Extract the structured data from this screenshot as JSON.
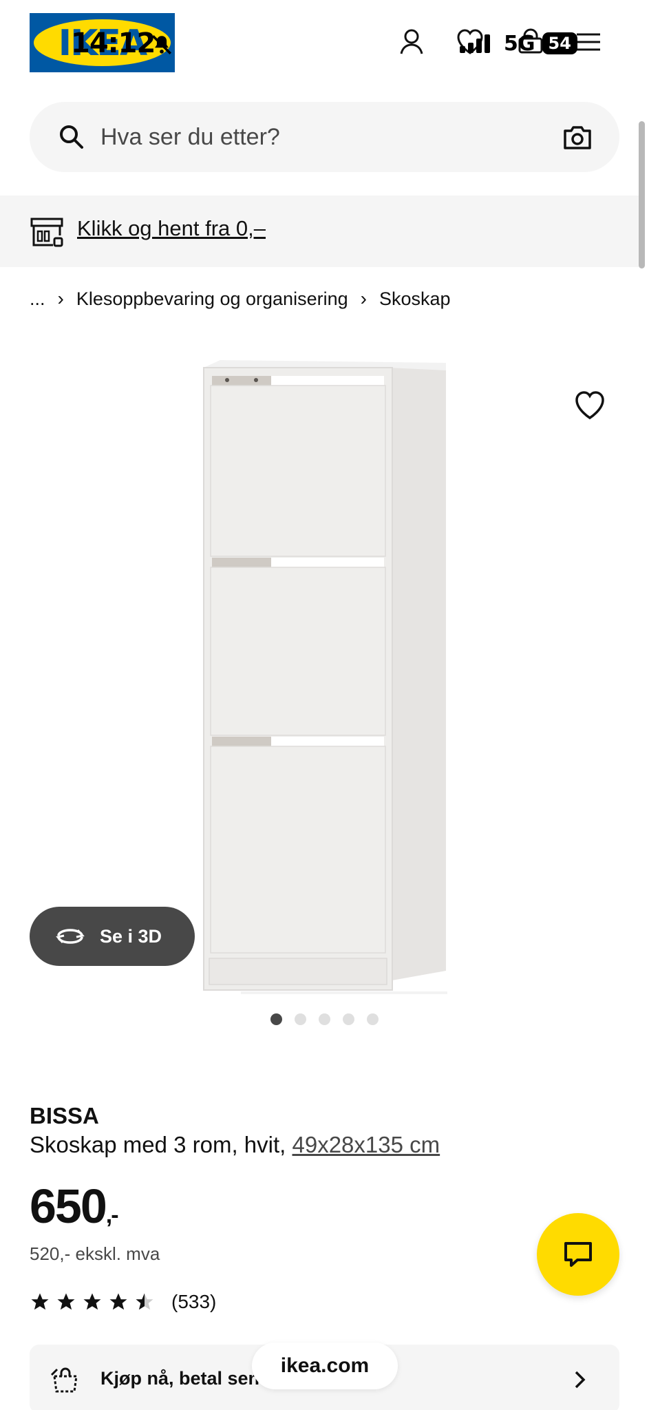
{
  "status_bar": {
    "time": "14:12",
    "network": "5G",
    "battery": "54"
  },
  "header": {
    "logo_text": "IKEA"
  },
  "search": {
    "placeholder": "Hva ser du etter?"
  },
  "promo": {
    "text": "Klikk og hent fra 0,–"
  },
  "breadcrumb": {
    "ellipsis": "...",
    "items": [
      "Klesoppbevaring og organisering",
      "Skoskap"
    ]
  },
  "gallery": {
    "view_3d_label": "Se i 3D",
    "image_count": 5,
    "active_index": 0
  },
  "product": {
    "name": "BISSA",
    "description": "Skoskap med 3 rom, hvit,",
    "dimensions": "49x28x135 cm",
    "price": "650",
    "price_suffix": ",-",
    "price_ex_vat": "520,- ekskl. mva",
    "rating": 4.5,
    "rating_max": 5,
    "review_count": "(533)"
  },
  "pay_later": {
    "text": "Kjøp nå, betal senere"
  },
  "browser": {
    "url": "ikea.com"
  },
  "colors": {
    "brand_blue": "#0058a3",
    "brand_yellow": "#ffdb00",
    "button_dark": "#484848",
    "surface_grey": "#f5f5f5"
  },
  "icons": [
    "person-icon",
    "heart-icon",
    "shopping-bag-icon",
    "menu-icon",
    "search-icon",
    "camera-icon",
    "store-icon",
    "rotate-3d-icon",
    "chat-icon",
    "chevron-right-icon",
    "star-icon"
  ]
}
